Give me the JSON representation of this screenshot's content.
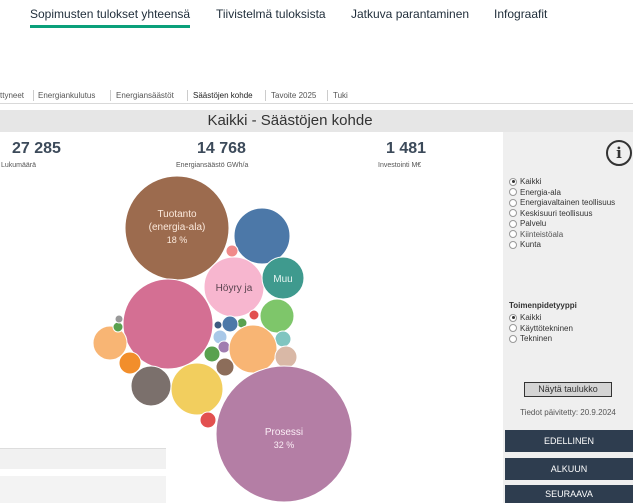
{
  "topnav": {
    "tabs": [
      {
        "label": "Sopimusten tulokset yhteensä",
        "active": true
      },
      {
        "label": "Tiivistelmä tuloksista",
        "active": false
      },
      {
        "label": "Jatkuva parantaminen",
        "active": false
      },
      {
        "label": "Infograafit",
        "active": false
      }
    ],
    "accent": "#0aa07a"
  },
  "subtabs": [
    "ttyneet",
    "Energiankulutus",
    "Energiansäästöt",
    "Säästöjen kohde",
    "Tavoite 2025",
    "Tuki"
  ],
  "title": "Kaikki - Säästöjen kohde",
  "kpis": [
    {
      "value": "27 285",
      "label": "Lukumäärä"
    },
    {
      "value": "14 768",
      "label": "Energiansäästö GWh/a"
    },
    {
      "value": "1 481",
      "label": "Investointi M€"
    }
  ],
  "bubbles": {
    "labels": {
      "tuotanto": [
        "Tuotanto",
        "(energia-ala)",
        "18 %"
      ],
      "hoyry": "Höyry ja",
      "muu": "Muu",
      "prosessi": [
        "Prosessi",
        "32 %"
      ]
    },
    "colors": {
      "tuotanto": "#9c6b4e",
      "blue": "#4c78a8",
      "muu": "#3f9a8e",
      "hoyry": "#f7b6cf",
      "pink": "#d46f93",
      "green": "#7ec66a",
      "orange": "#f8b574",
      "yellow": "#f2ce5e",
      "gray": "#7b706c",
      "prosessi": "#b47ea5",
      "red": "#e2504f"
    }
  },
  "panel": {
    "info_glyph": "i",
    "sector_options": [
      {
        "label": "Kaikki",
        "selected": true
      },
      {
        "label": "Energia-ala",
        "selected": false
      },
      {
        "label": "Energiavaltainen teollisuus",
        "selected": false
      },
      {
        "label": "Keskisuuri teollisuus",
        "selected": false
      },
      {
        "label": "Palvelu",
        "selected": false
      },
      {
        "label": "Kiinteistöala",
        "selected": false
      },
      {
        "label": "Kunta",
        "selected": false
      }
    ],
    "measure_title": "Toimenpidetyyppi",
    "measure_options": [
      {
        "label": "Kaikki",
        "selected": true
      },
      {
        "label": "Käyttötekninen",
        "selected": false
      },
      {
        "label": "Tekninen",
        "selected": false
      }
    ],
    "show_table": "Näytä taulukko",
    "updated": "Tiedot päivitetty: 20.9.2024",
    "btn_prev": "EDELLINEN",
    "btn_start": "ALKUUN",
    "btn_next": "SEURAAVA",
    "btn_color": "#2e3d4f"
  }
}
